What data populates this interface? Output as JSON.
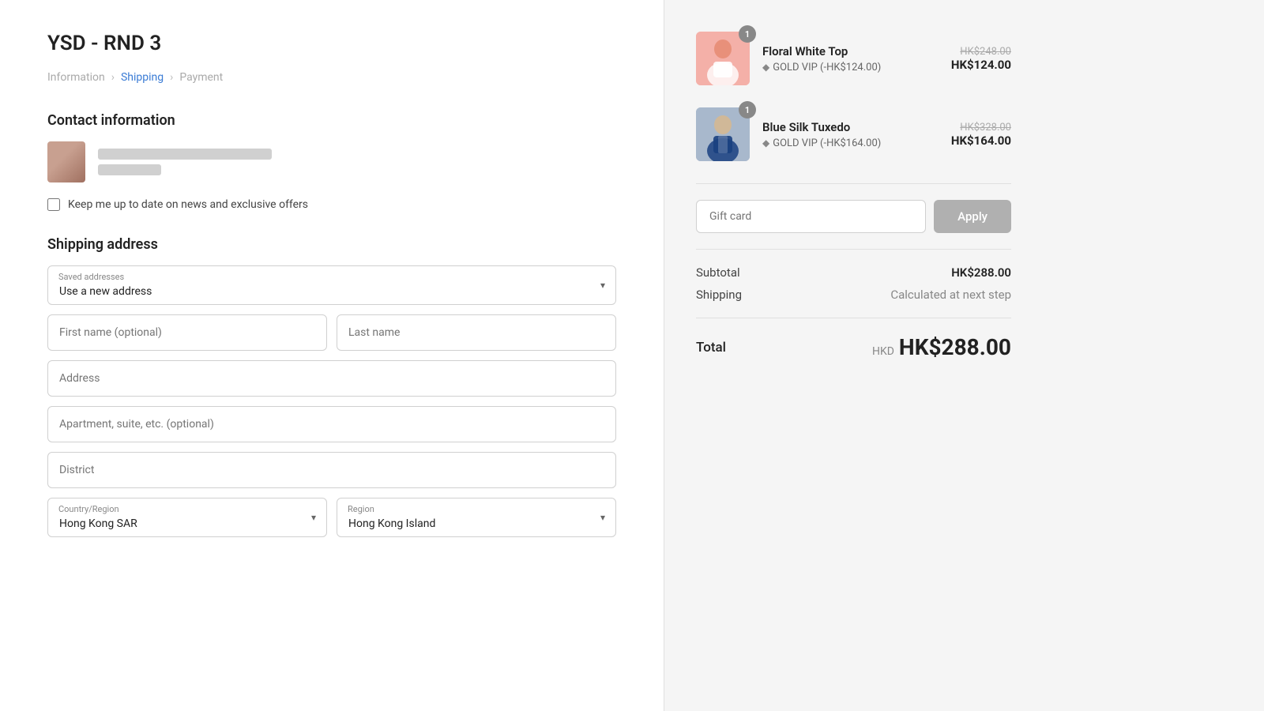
{
  "store": {
    "title": "YSD - RND 3"
  },
  "breadcrumb": {
    "items": [
      {
        "label": "Information",
        "active": false
      },
      {
        "label": "Shipping",
        "active": true
      },
      {
        "label": "Payment",
        "active": false
      }
    ]
  },
  "contact": {
    "section_title": "Contact information",
    "newsletter_label": "Keep me up to date on news and exclusive offers"
  },
  "shipping": {
    "section_title": "Shipping address",
    "saved_addresses_label": "Saved addresses",
    "saved_addresses_value": "Use a new address",
    "first_name_placeholder": "First name (optional)",
    "last_name_placeholder": "Last name",
    "address_placeholder": "Address",
    "apartment_placeholder": "Apartment, suite, etc. (optional)",
    "district_placeholder": "District",
    "country_label": "Country/Region",
    "country_value": "Hong Kong SAR",
    "region_label": "Region",
    "region_value": "Hong Kong Island"
  },
  "order": {
    "items": [
      {
        "id": 1,
        "name": "Floral White Top",
        "vip_text": "GOLD VIP (-HK$124.00)",
        "original_price": "HK$248.00",
        "final_price": "HK$124.00",
        "quantity": 1,
        "color_type": "pink"
      },
      {
        "id": 2,
        "name": "Blue Silk Tuxedo",
        "vip_text": "GOLD VIP (-HK$164.00)",
        "original_price": "HK$328.00",
        "final_price": "HK$164.00",
        "quantity": 1,
        "color_type": "blue"
      }
    ],
    "gift_card_placeholder": "Gift card",
    "apply_button": "Apply",
    "subtotal_label": "Subtotal",
    "subtotal_value": "HK$288.00",
    "shipping_label": "Shipping",
    "shipping_value": "Calculated at next step",
    "total_label": "Total",
    "total_currency": "HKD",
    "total_amount": "HK$288.00"
  }
}
